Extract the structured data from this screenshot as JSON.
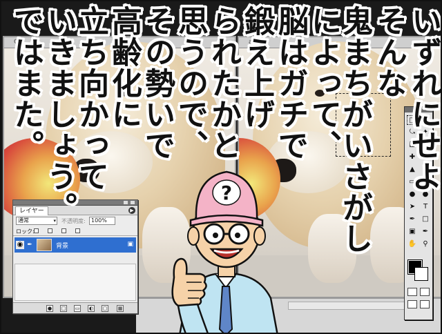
{
  "window_titles": {
    "left": "GF",
    "right": "a.jpg"
  },
  "layers_panel": {
    "tab_label": "レイヤー",
    "blend_mode": "通常",
    "opacity_label": "不透明度:",
    "opacity_value": "100%",
    "lock_label": "ロック:",
    "layer_name": "背景"
  },
  "speech_columns": [
    "いずれにせよ",
    "そんな",
    "鬼まちがいさがし",
    "によって、",
    "脳はガチで",
    "鍛え上げ",
    "られたかと",
    "思うので、",
    "その勢いで",
    "高齢化に",
    "立ち向かって",
    "いきましょう。",
    "ではまた。"
  ],
  "character": {
    "hat_symbol": "?"
  },
  "colors": {
    "layer_selected": "#2f6fd0",
    "hat_pink": "#f4b3c7",
    "shirt_blue": "#bfe4f2",
    "tie_blue": "#5f86c8",
    "skin": "#f6d2a8",
    "peach_red": "#d84a3c"
  }
}
